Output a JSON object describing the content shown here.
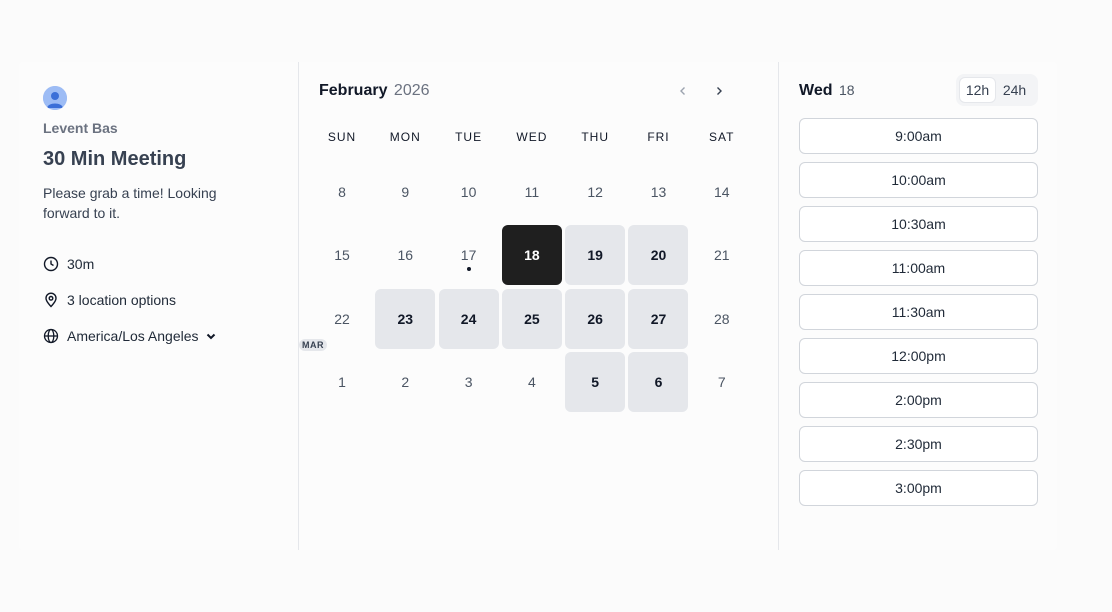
{
  "host": {
    "name": "Levent Bas"
  },
  "event": {
    "title": "30 Min Meeting",
    "description": "Please grab a time! Looking forward to it.",
    "duration": "30m",
    "locations": "3 location options",
    "timezone": "America/Los Angeles"
  },
  "calendar": {
    "month": "February",
    "year": "2026",
    "weekdays": [
      "SUN",
      "MON",
      "TUE",
      "WED",
      "THU",
      "FRI",
      "SAT"
    ],
    "days": [
      {
        "label": "8",
        "state": "disabled"
      },
      {
        "label": "9",
        "state": "disabled"
      },
      {
        "label": "10",
        "state": "disabled"
      },
      {
        "label": "11",
        "state": "disabled"
      },
      {
        "label": "12",
        "state": "disabled"
      },
      {
        "label": "13",
        "state": "disabled"
      },
      {
        "label": "14",
        "state": "disabled"
      },
      {
        "label": "15",
        "state": "disabled"
      },
      {
        "label": "16",
        "state": "disabled"
      },
      {
        "label": "17",
        "state": "today"
      },
      {
        "label": "18",
        "state": "selected"
      },
      {
        "label": "19",
        "state": "available"
      },
      {
        "label": "20",
        "state": "available"
      },
      {
        "label": "21",
        "state": "disabled"
      },
      {
        "label": "22",
        "state": "disabled"
      },
      {
        "label": "23",
        "state": "available"
      },
      {
        "label": "24",
        "state": "available"
      },
      {
        "label": "25",
        "state": "available"
      },
      {
        "label": "26",
        "state": "available"
      },
      {
        "label": "27",
        "state": "available"
      },
      {
        "label": "28",
        "state": "disabled"
      },
      {
        "label": "1",
        "state": "disabled",
        "badge": "MAR"
      },
      {
        "label": "2",
        "state": "disabled"
      },
      {
        "label": "3",
        "state": "disabled"
      },
      {
        "label": "4",
        "state": "disabled"
      },
      {
        "label": "5",
        "state": "available"
      },
      {
        "label": "6",
        "state": "available"
      },
      {
        "label": "7",
        "state": "disabled"
      }
    ]
  },
  "selected_date": {
    "weekday": "Wed",
    "day": "18"
  },
  "time_format": {
    "options": [
      "12h",
      "24h"
    ],
    "active": "12h"
  },
  "slots": [
    "9:00am",
    "10:00am",
    "10:30am",
    "11:00am",
    "11:30am",
    "12:00pm",
    "2:00pm",
    "2:30pm",
    "3:00pm"
  ]
}
